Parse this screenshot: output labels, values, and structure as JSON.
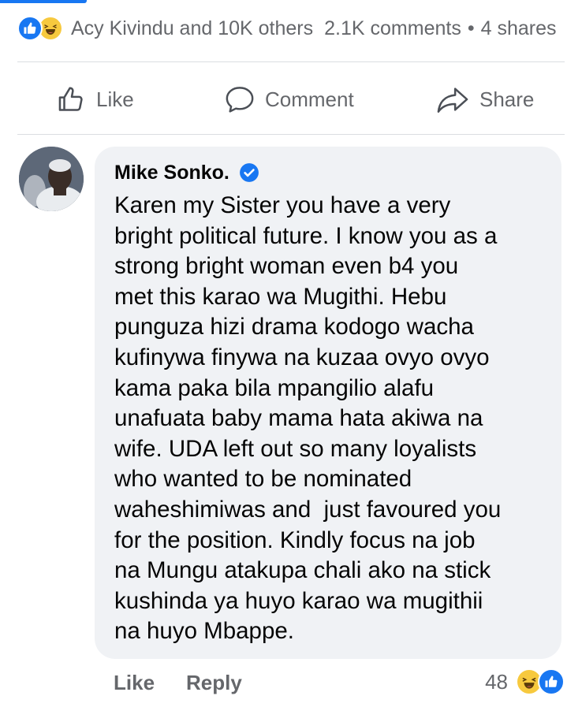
{
  "post_summary": {
    "reactors_text": "Acy Kivindu and 10K others",
    "comments_text": "2.1K comments",
    "separator": "•",
    "shares_text": "4 shares",
    "reaction_icons": [
      "like-icon",
      "haha-icon"
    ]
  },
  "actions": {
    "like_label": "Like",
    "comment_label": "Comment",
    "share_label": "Share"
  },
  "comment": {
    "author": "Mike Sonko.",
    "verified": true,
    "text": "Karen my Sister you have a very\nbright political future. I know you as a\nstrong bright woman even b4 you\nmet this karao wa Mugithi. Hebu\npunguza hizi drama kodogo wacha\nkufinywa finywa na kuzaa ovyo ovyo\nkama paka bila mpangilio alafu\nunafuata baby mama hata akiwa na\nwife. UDA left out so many loyalists\nwho wanted to be nominated\nwaheshimiwas and  just favoured you\nfor the position. Kindly focus na job\nna Mungu atakupa chali ako na stick\nkushinda ya huyo karao wa mugithii\nna huyo Mbappe.",
    "like_label": "Like",
    "reply_label": "Reply",
    "reaction_count": "48",
    "reaction_icons": [
      "haha-icon",
      "like-icon"
    ]
  },
  "colors": {
    "brand_blue": "#1877f2",
    "secondary_text": "#65676b",
    "bubble_bg": "#f0f2f5",
    "haha_yellow": "#f7c93e"
  }
}
